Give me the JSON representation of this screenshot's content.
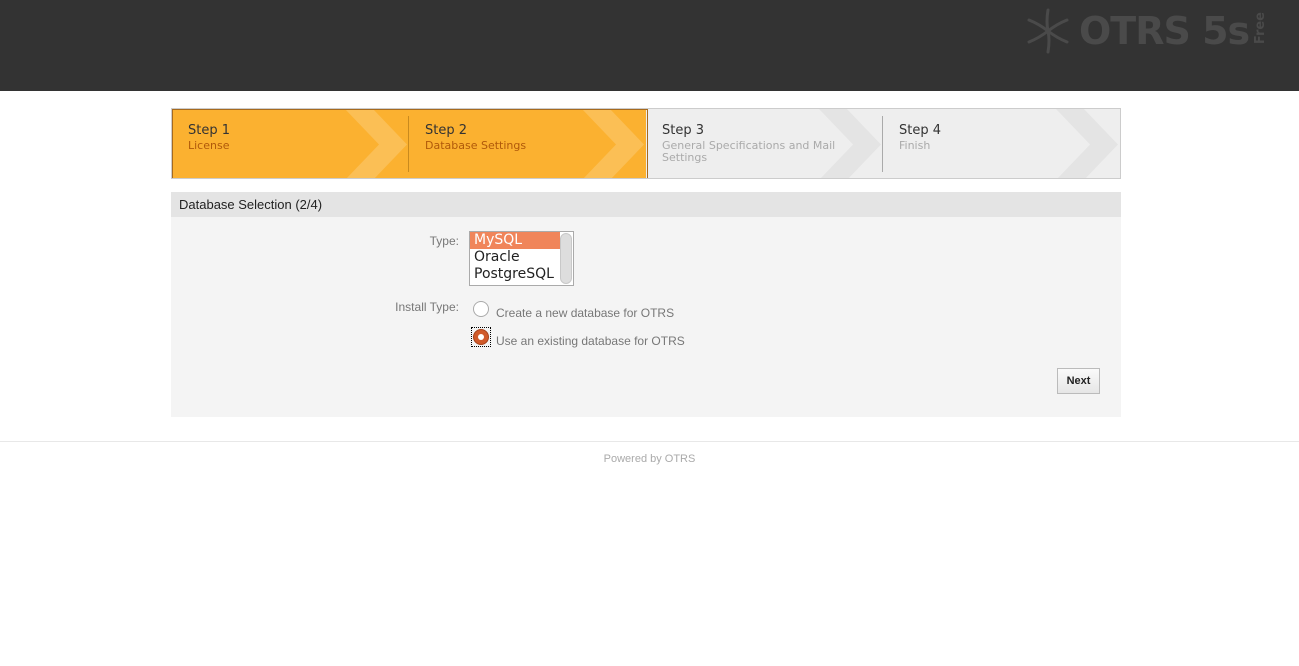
{
  "header": {
    "logo_text": "OTRS 5s",
    "logo_badge": "Free"
  },
  "steps": [
    {
      "title": "Step 1",
      "subtitle": "License",
      "state": "done"
    },
    {
      "title": "Step 2",
      "subtitle": "Database Settings",
      "state": "active"
    },
    {
      "title": "Step 3",
      "subtitle": "General Specifications and Mail Settings",
      "state": "pending"
    },
    {
      "title": "Step 4",
      "subtitle": "Finish",
      "state": "pending"
    }
  ],
  "panel": {
    "title": "Database Selection (2/4)",
    "type_label": "Type:",
    "type_options": [
      "MySQL",
      "Oracle",
      "PostgreSQL"
    ],
    "type_selected": "MySQL",
    "install_type_label": "Install Type:",
    "install_options": [
      "Create a new database for OTRS",
      "Use an existing database for OTRS"
    ],
    "install_selected": "Use an existing database for OTRS",
    "next_label": "Next"
  },
  "footer": {
    "text": "Powered by OTRS"
  },
  "colors": {
    "header": "#333333",
    "active_step": "#fbb130",
    "selected_option": "#f0855a",
    "radio_on": "#d05a2a"
  }
}
